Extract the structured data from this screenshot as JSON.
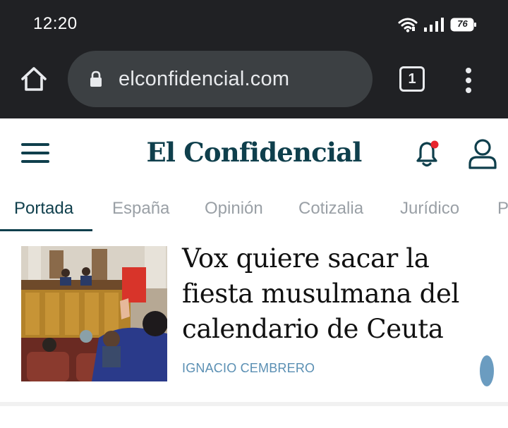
{
  "status_bar": {
    "time": "12:20",
    "battery_level": "76",
    "icons": [
      "wifi-icon",
      "signal-icon",
      "battery-icon"
    ]
  },
  "browser": {
    "url": "elconfidencial.com",
    "tab_count": "1",
    "icons": [
      "home-icon",
      "lock-icon",
      "tabs-icon",
      "more-vert-icon"
    ]
  },
  "site": {
    "logo_text": "El Confidencial",
    "brand_color": "#0f3f4c",
    "notification_dot_color": "#e8252e",
    "icons": [
      "hamburger-menu-icon",
      "bell-icon",
      "user-icon"
    ]
  },
  "sections": {
    "tabs": [
      {
        "label": "Portada",
        "active": true
      },
      {
        "label": "España",
        "active": false
      },
      {
        "label": "Opinión",
        "active": false
      },
      {
        "label": "Cotizalia",
        "active": false
      },
      {
        "label": "Jurídico",
        "active": false
      },
      {
        "label": "P",
        "active": false
      }
    ]
  },
  "article": {
    "headline": "Vox quiere sacar la fiesta musulmana del calendario de Ceuta",
    "author": "IGNACIO CEMBRERO",
    "author_color": "#5a8fb3",
    "icons": [
      "more-vert-icon"
    ]
  }
}
